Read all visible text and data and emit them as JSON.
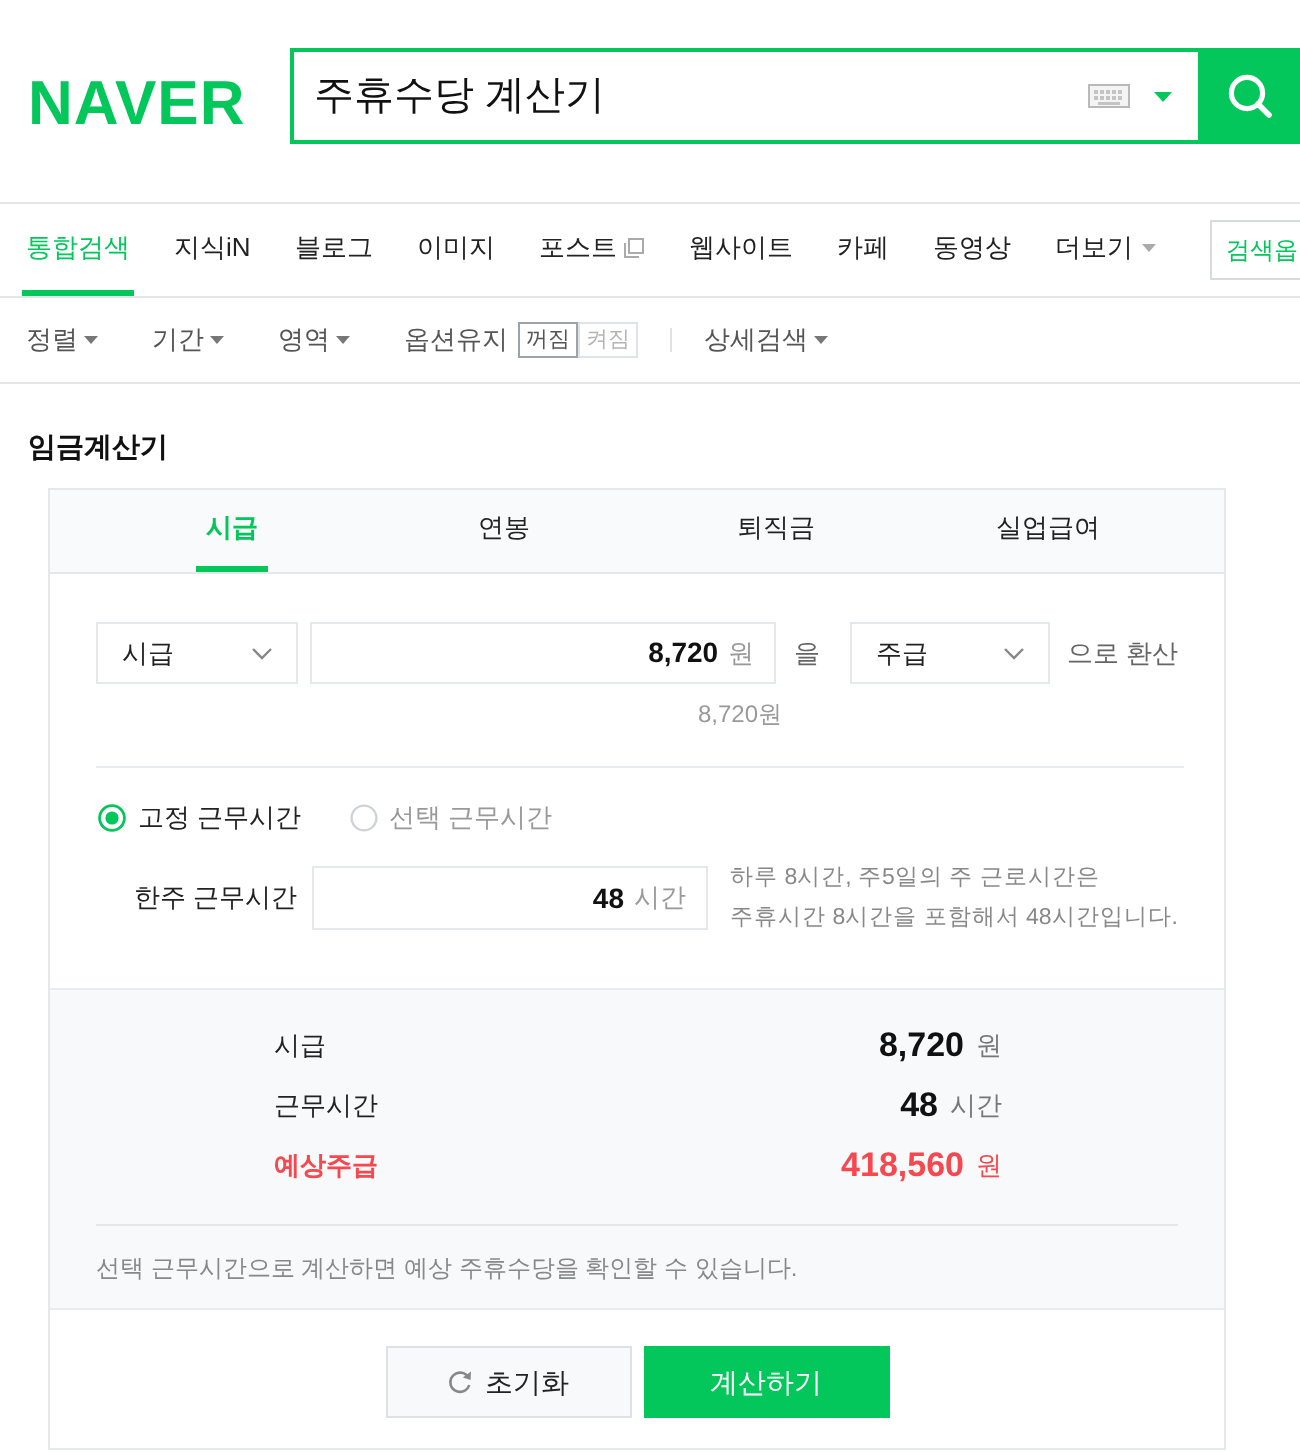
{
  "header": {
    "logo": "NAVER",
    "query": "주휴수당 계산기"
  },
  "nav_tabs": [
    {
      "label": "통합검색",
      "selected": true,
      "kind": "plain"
    },
    {
      "label": "지식iN",
      "selected": false,
      "kind": "plain"
    },
    {
      "label": "블로그",
      "selected": false,
      "kind": "plain"
    },
    {
      "label": "이미지",
      "selected": false,
      "kind": "plain"
    },
    {
      "label": "포스트",
      "selected": false,
      "kind": "popup"
    },
    {
      "label": "웹사이트",
      "selected": false,
      "kind": "plain"
    },
    {
      "label": "카페",
      "selected": false,
      "kind": "plain"
    },
    {
      "label": "동영상",
      "selected": false,
      "kind": "plain"
    },
    {
      "label": "더보기",
      "selected": false,
      "kind": "dropdown"
    }
  ],
  "search_options_button": "검색옵",
  "filter_bar": {
    "dropdowns": [
      "정렬",
      "기간",
      "영역"
    ],
    "option_keep": {
      "label": "옵션유지",
      "options": [
        {
          "label": "꺼짐",
          "selected": true
        },
        {
          "label": "켜짐",
          "selected": false
        }
      ]
    },
    "detail_search": "상세검색"
  },
  "calculator": {
    "title": "임금계산기",
    "tabs": [
      {
        "label": "시급",
        "selected": true
      },
      {
        "label": "연봉",
        "selected": false
      },
      {
        "label": "퇴직금",
        "selected": false
      },
      {
        "label": "실업급여",
        "selected": false
      }
    ],
    "conversion": {
      "from": "시급",
      "amount": "8,720",
      "amount_unit": "원",
      "particle": "을",
      "to": "주급",
      "suffix": "으로 환산",
      "amount_hint": "8,720원"
    },
    "work_type": [
      {
        "label": "고정 근무시간",
        "selected": true
      },
      {
        "label": "선택 근무시간",
        "selected": false
      }
    ],
    "weekly_hours": {
      "label": "한주 근무시간",
      "value": "48",
      "unit": "시간",
      "description": "하루 8시간, 주5일의 주 근로시간은\n주휴시간 8시간을 포함해서 48시간입니다."
    },
    "results": [
      {
        "label": "시급",
        "value": "8,720",
        "unit": "원",
        "highlight": false
      },
      {
        "label": "근무시간",
        "value": "48",
        "unit": "시간",
        "highlight": false
      },
      {
        "label": "예상주급",
        "value": "418,560",
        "unit": "원",
        "highlight": true
      }
    ],
    "note": "선택 근무시간으로 계산하면 예상 주휴수당을 확인할 수 있습니다.",
    "buttons": [
      {
        "label": "초기화",
        "kind": "reset"
      },
      {
        "label": "계산하기",
        "kind": "primary"
      }
    ]
  }
}
